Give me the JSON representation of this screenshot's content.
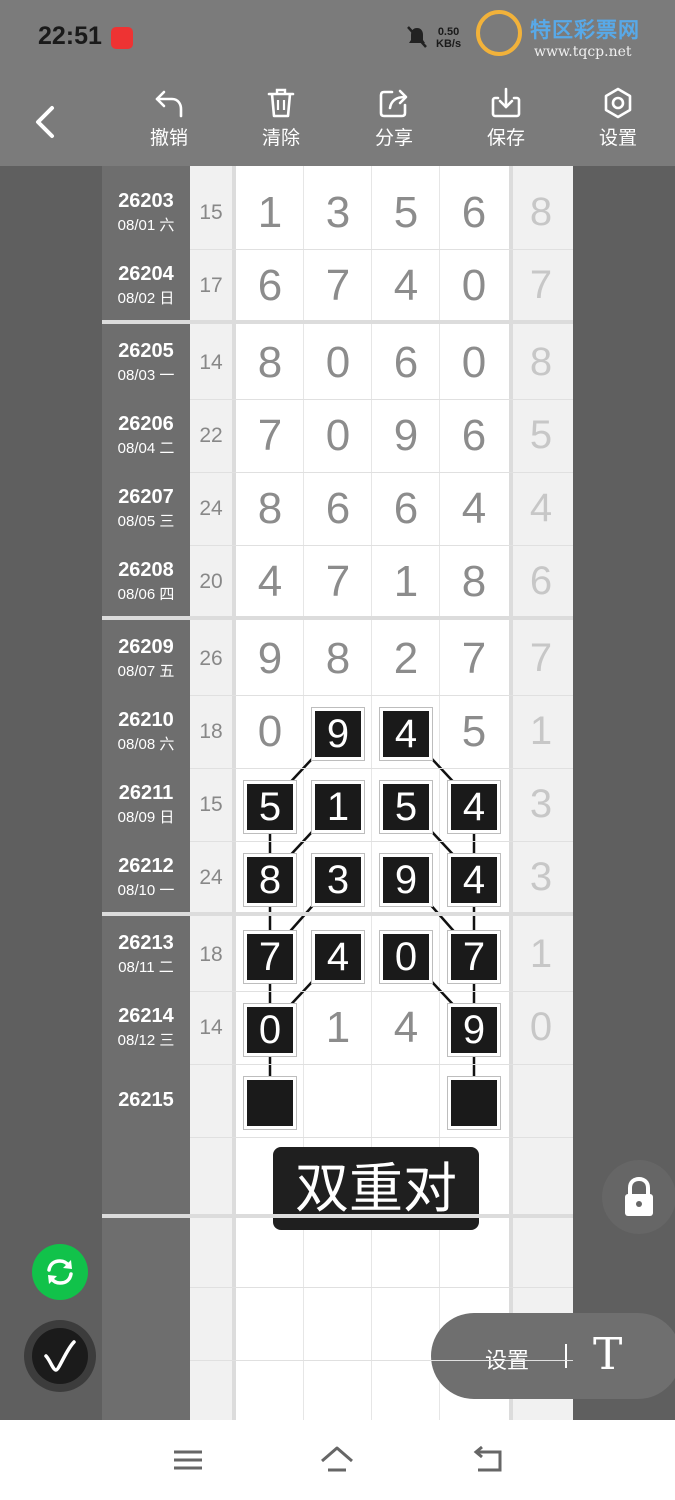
{
  "status": {
    "time": "22:51",
    "net_speed": "0.50",
    "net_unit": "KB/s"
  },
  "watermark": {
    "title": "特区彩票网",
    "url": "www.tqcp.net"
  },
  "toolbar": {
    "undo": "撤销",
    "clear": "清除",
    "share": "分享",
    "save": "保存",
    "settings": "设置"
  },
  "rows": [
    {
      "id": "26203",
      "date": "08/01 六",
      "sum": "15",
      "digits": [
        "1",
        "3",
        "5",
        "6"
      ],
      "extra": "8",
      "hl": []
    },
    {
      "id": "26204",
      "date": "08/02 日",
      "sum": "17",
      "digits": [
        "6",
        "7",
        "4",
        "0"
      ],
      "extra": "7",
      "hl": []
    },
    {
      "id": "26205",
      "date": "08/03 一",
      "sum": "14",
      "digits": [
        "8",
        "0",
        "6",
        "0"
      ],
      "extra": "8",
      "hl": []
    },
    {
      "id": "26206",
      "date": "08/04 二",
      "sum": "22",
      "digits": [
        "7",
        "0",
        "9",
        "6"
      ],
      "extra": "5",
      "hl": []
    },
    {
      "id": "26207",
      "date": "08/05 三",
      "sum": "24",
      "digits": [
        "8",
        "6",
        "6",
        "4"
      ],
      "extra": "4",
      "hl": []
    },
    {
      "id": "26208",
      "date": "08/06 四",
      "sum": "20",
      "digits": [
        "4",
        "7",
        "1",
        "8"
      ],
      "extra": "6",
      "hl": []
    },
    {
      "id": "26209",
      "date": "08/07 五",
      "sum": "26",
      "digits": [
        "9",
        "8",
        "2",
        "7"
      ],
      "extra": "7",
      "hl": []
    },
    {
      "id": "26210",
      "date": "08/08 六",
      "sum": "18",
      "digits": [
        "0",
        "9",
        "4",
        "5"
      ],
      "extra": "1",
      "hl": [
        1,
        2
      ]
    },
    {
      "id": "26211",
      "date": "08/09 日",
      "sum": "15",
      "digits": [
        "5",
        "1",
        "5",
        "4"
      ],
      "extra": "3",
      "hl": [
        0,
        1,
        2,
        3
      ]
    },
    {
      "id": "26212",
      "date": "08/10 一",
      "sum": "24",
      "digits": [
        "8",
        "3",
        "9",
        "4"
      ],
      "extra": "3",
      "hl": [
        0,
        1,
        2,
        3
      ]
    },
    {
      "id": "26213",
      "date": "08/11 二",
      "sum": "18",
      "digits": [
        "7",
        "4",
        "0",
        "7"
      ],
      "extra": "1",
      "hl": [
        0,
        1,
        2,
        3
      ]
    },
    {
      "id": "26214",
      "date": "08/12 三",
      "sum": "14",
      "digits": [
        "0",
        "1",
        "4",
        "9"
      ],
      "extra": "0",
      "hl": [
        0,
        3
      ]
    },
    {
      "id": "26215",
      "date": "",
      "sum": "",
      "digits": [
        "",
        "",
        "",
        ""
      ],
      "extra": "",
      "hl": [],
      "empty_boxes": [
        0,
        3
      ]
    }
  ],
  "label": "双重对",
  "text_bar": {
    "settings": "设置",
    "text_tool": "T"
  },
  "colors": {
    "accent_green": "#11c24a",
    "highlight_box": "#1a1a1a"
  }
}
